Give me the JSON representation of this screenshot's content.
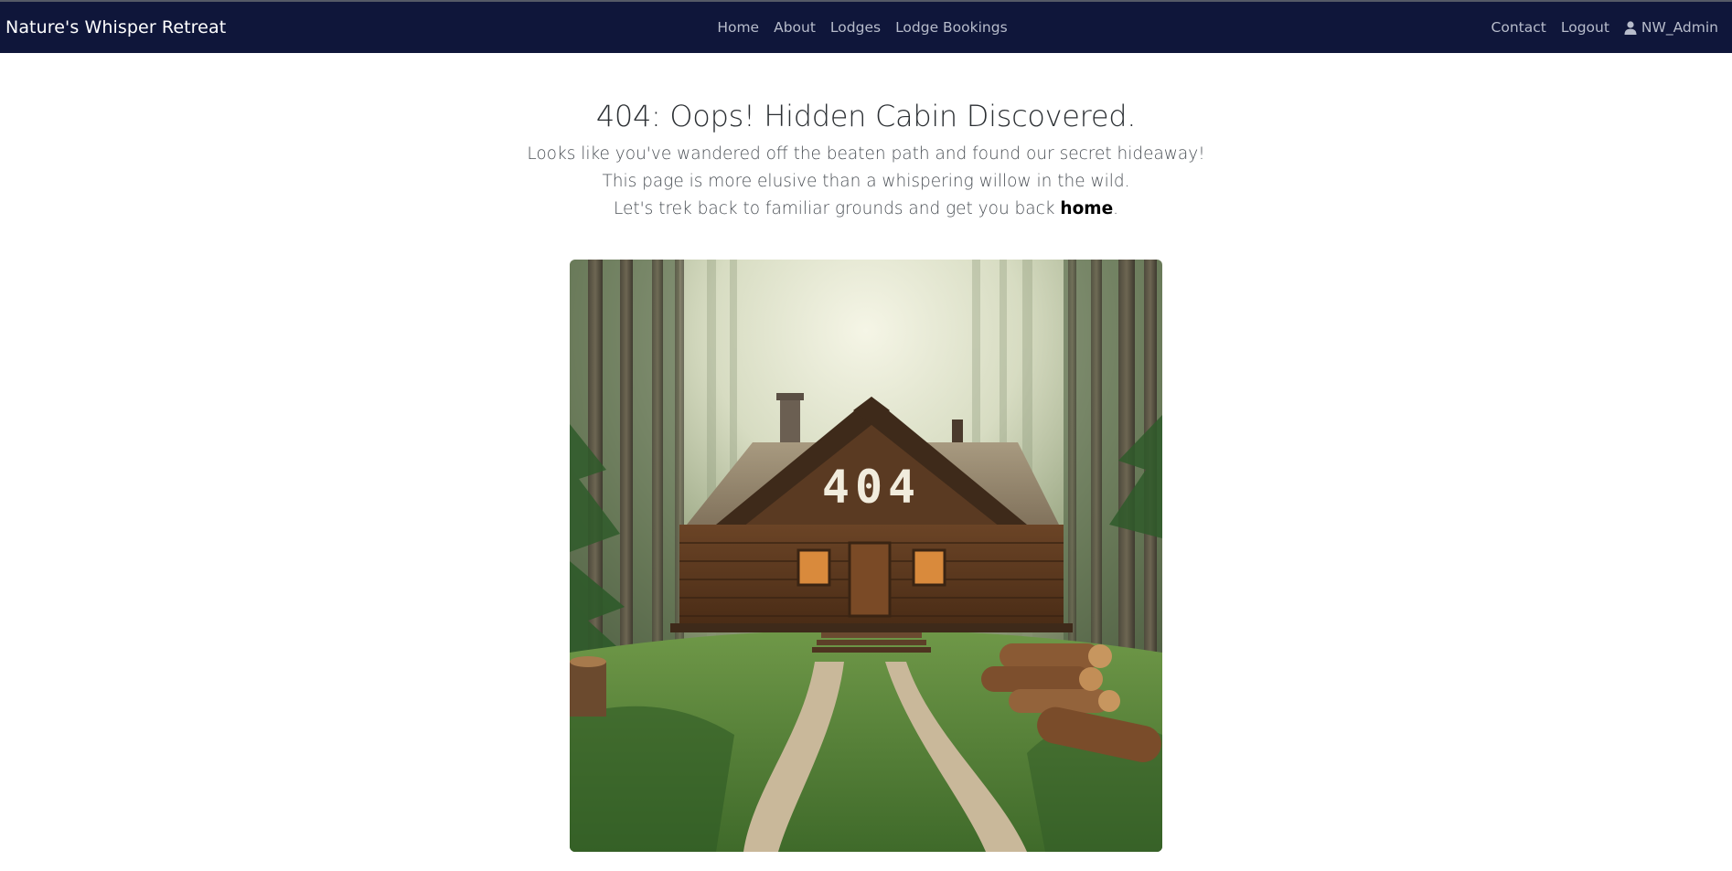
{
  "navbar": {
    "brand": "Nature's Whisper Retreat",
    "center_links": [
      "Home",
      "About",
      "Lodges",
      "Lodge Bookings"
    ],
    "contact": "Contact",
    "logout": "Logout",
    "username": "NW_Admin"
  },
  "content": {
    "title": "404: Oops! Hidden Cabin Discovered.",
    "line1": "Looks like you've wandered off the beaten path and found our secret hideaway!",
    "line2": "This page is more elusive than a whispering willow in the wild.",
    "line3_prefix": "Let's trek back to familiar grounds and get you back ",
    "home_link": "home",
    "line3_suffix": "."
  },
  "image": {
    "sign_text": "404"
  },
  "colors": {
    "navbar_bg": "#0f163a",
    "nav_link": "#b7bccb",
    "brand": "#ffffff"
  }
}
